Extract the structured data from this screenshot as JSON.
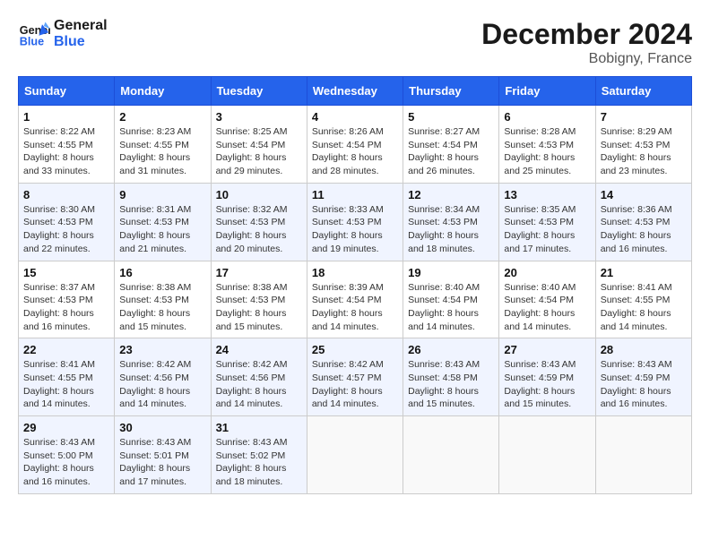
{
  "header": {
    "logo_line1": "General",
    "logo_line2": "Blue",
    "month_title": "December 2024",
    "location": "Bobigny, France"
  },
  "weekdays": [
    "Sunday",
    "Monday",
    "Tuesday",
    "Wednesday",
    "Thursday",
    "Friday",
    "Saturday"
  ],
  "weeks": [
    [
      {
        "day": "1",
        "sunrise": "Sunrise: 8:22 AM",
        "sunset": "Sunset: 4:55 PM",
        "daylight": "Daylight: 8 hours and 33 minutes."
      },
      {
        "day": "2",
        "sunrise": "Sunrise: 8:23 AM",
        "sunset": "Sunset: 4:55 PM",
        "daylight": "Daylight: 8 hours and 31 minutes."
      },
      {
        "day": "3",
        "sunrise": "Sunrise: 8:25 AM",
        "sunset": "Sunset: 4:54 PM",
        "daylight": "Daylight: 8 hours and 29 minutes."
      },
      {
        "day": "4",
        "sunrise": "Sunrise: 8:26 AM",
        "sunset": "Sunset: 4:54 PM",
        "daylight": "Daylight: 8 hours and 28 minutes."
      },
      {
        "day": "5",
        "sunrise": "Sunrise: 8:27 AM",
        "sunset": "Sunset: 4:54 PM",
        "daylight": "Daylight: 8 hours and 26 minutes."
      },
      {
        "day": "6",
        "sunrise": "Sunrise: 8:28 AM",
        "sunset": "Sunset: 4:53 PM",
        "daylight": "Daylight: 8 hours and 25 minutes."
      },
      {
        "day": "7",
        "sunrise": "Sunrise: 8:29 AM",
        "sunset": "Sunset: 4:53 PM",
        "daylight": "Daylight: 8 hours and 23 minutes."
      }
    ],
    [
      {
        "day": "8",
        "sunrise": "Sunrise: 8:30 AM",
        "sunset": "Sunset: 4:53 PM",
        "daylight": "Daylight: 8 hours and 22 minutes."
      },
      {
        "day": "9",
        "sunrise": "Sunrise: 8:31 AM",
        "sunset": "Sunset: 4:53 PM",
        "daylight": "Daylight: 8 hours and 21 minutes."
      },
      {
        "day": "10",
        "sunrise": "Sunrise: 8:32 AM",
        "sunset": "Sunset: 4:53 PM",
        "daylight": "Daylight: 8 hours and 20 minutes."
      },
      {
        "day": "11",
        "sunrise": "Sunrise: 8:33 AM",
        "sunset": "Sunset: 4:53 PM",
        "daylight": "Daylight: 8 hours and 19 minutes."
      },
      {
        "day": "12",
        "sunrise": "Sunrise: 8:34 AM",
        "sunset": "Sunset: 4:53 PM",
        "daylight": "Daylight: 8 hours and 18 minutes."
      },
      {
        "day": "13",
        "sunrise": "Sunrise: 8:35 AM",
        "sunset": "Sunset: 4:53 PM",
        "daylight": "Daylight: 8 hours and 17 minutes."
      },
      {
        "day": "14",
        "sunrise": "Sunrise: 8:36 AM",
        "sunset": "Sunset: 4:53 PM",
        "daylight": "Daylight: 8 hours and 16 minutes."
      }
    ],
    [
      {
        "day": "15",
        "sunrise": "Sunrise: 8:37 AM",
        "sunset": "Sunset: 4:53 PM",
        "daylight": "Daylight: 8 hours and 16 minutes."
      },
      {
        "day": "16",
        "sunrise": "Sunrise: 8:38 AM",
        "sunset": "Sunset: 4:53 PM",
        "daylight": "Daylight: 8 hours and 15 minutes."
      },
      {
        "day": "17",
        "sunrise": "Sunrise: 8:38 AM",
        "sunset": "Sunset: 4:53 PM",
        "daylight": "Daylight: 8 hours and 15 minutes."
      },
      {
        "day": "18",
        "sunrise": "Sunrise: 8:39 AM",
        "sunset": "Sunset: 4:54 PM",
        "daylight": "Daylight: 8 hours and 14 minutes."
      },
      {
        "day": "19",
        "sunrise": "Sunrise: 8:40 AM",
        "sunset": "Sunset: 4:54 PM",
        "daylight": "Daylight: 8 hours and 14 minutes."
      },
      {
        "day": "20",
        "sunrise": "Sunrise: 8:40 AM",
        "sunset": "Sunset: 4:54 PM",
        "daylight": "Daylight: 8 hours and 14 minutes."
      },
      {
        "day": "21",
        "sunrise": "Sunrise: 8:41 AM",
        "sunset": "Sunset: 4:55 PM",
        "daylight": "Daylight: 8 hours and 14 minutes."
      }
    ],
    [
      {
        "day": "22",
        "sunrise": "Sunrise: 8:41 AM",
        "sunset": "Sunset: 4:55 PM",
        "daylight": "Daylight: 8 hours and 14 minutes."
      },
      {
        "day": "23",
        "sunrise": "Sunrise: 8:42 AM",
        "sunset": "Sunset: 4:56 PM",
        "daylight": "Daylight: 8 hours and 14 minutes."
      },
      {
        "day": "24",
        "sunrise": "Sunrise: 8:42 AM",
        "sunset": "Sunset: 4:56 PM",
        "daylight": "Daylight: 8 hours and 14 minutes."
      },
      {
        "day": "25",
        "sunrise": "Sunrise: 8:42 AM",
        "sunset": "Sunset: 4:57 PM",
        "daylight": "Daylight: 8 hours and 14 minutes."
      },
      {
        "day": "26",
        "sunrise": "Sunrise: 8:43 AM",
        "sunset": "Sunset: 4:58 PM",
        "daylight": "Daylight: 8 hours and 15 minutes."
      },
      {
        "day": "27",
        "sunrise": "Sunrise: 8:43 AM",
        "sunset": "Sunset: 4:59 PM",
        "daylight": "Daylight: 8 hours and 15 minutes."
      },
      {
        "day": "28",
        "sunrise": "Sunrise: 8:43 AM",
        "sunset": "Sunset: 4:59 PM",
        "daylight": "Daylight: 8 hours and 16 minutes."
      }
    ],
    [
      {
        "day": "29",
        "sunrise": "Sunrise: 8:43 AM",
        "sunset": "Sunset: 5:00 PM",
        "daylight": "Daylight: 8 hours and 16 minutes."
      },
      {
        "day": "30",
        "sunrise": "Sunrise: 8:43 AM",
        "sunset": "Sunset: 5:01 PM",
        "daylight": "Daylight: 8 hours and 17 minutes."
      },
      {
        "day": "31",
        "sunrise": "Sunrise: 8:43 AM",
        "sunset": "Sunset: 5:02 PM",
        "daylight": "Daylight: 8 hours and 18 minutes."
      },
      null,
      null,
      null,
      null
    ]
  ]
}
